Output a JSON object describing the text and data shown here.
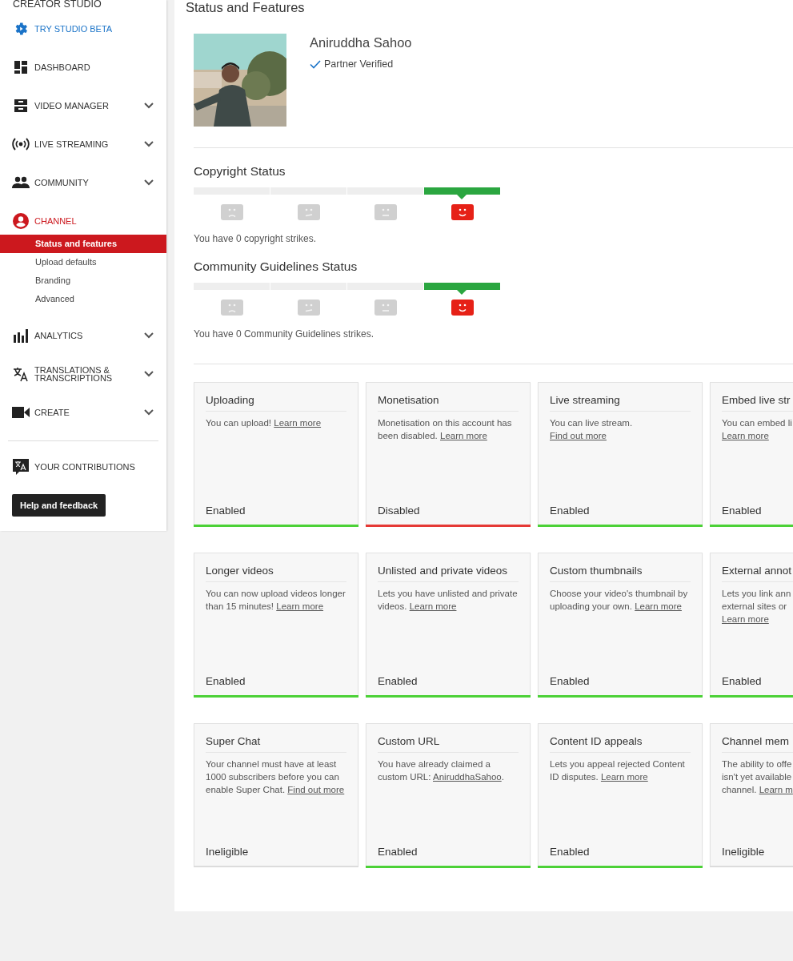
{
  "sidebar": {
    "heading": "CREATOR STUDIO",
    "items": [
      {
        "kind": "promo",
        "label": "TRY STUDIO BETA",
        "selected": false
      },
      {
        "kind": "link",
        "label": "DASHBOARD",
        "selected": false
      },
      {
        "kind": "group",
        "label": "VIDEO MANAGER",
        "selected": false,
        "expanded": false
      },
      {
        "kind": "group",
        "label": "LIVE STREAMING",
        "selected": false,
        "expanded": false
      },
      {
        "kind": "group",
        "label": "COMMUNITY",
        "selected": false,
        "expanded": false
      },
      {
        "kind": "link",
        "label": "CHANNEL",
        "selected": true,
        "children": [
          {
            "label": "Status and features",
            "selected": true
          },
          {
            "label": "Upload defaults",
            "selected": false
          },
          {
            "label": "Branding",
            "selected": false
          },
          {
            "label": "Advanced",
            "selected": false
          }
        ]
      },
      {
        "kind": "group",
        "label": "ANALYTICS",
        "selected": false,
        "expanded": false
      },
      {
        "kind": "group",
        "label": "TRANSLATIONS & TRANSCRIPTIONS",
        "selected": false,
        "expanded": false
      },
      {
        "kind": "group",
        "label": "CREATE",
        "selected": false,
        "expanded": false
      }
    ],
    "footer_items": [
      {
        "label": "YOUR CONTRIBUTIONS"
      }
    ],
    "help_button": "Help and feedback"
  },
  "page": {
    "title": "Status and Features",
    "profile": {
      "name": "Aniruddha Sahoo",
      "badge": "Partner Verified"
    },
    "statuses": [
      {
        "title": "Copyright Status",
        "meter": [
          {
            "kind": "sad",
            "selected": false
          },
          {
            "kind": "confused",
            "selected": false
          },
          {
            "kind": "neutral",
            "selected": false
          },
          {
            "kind": "happy",
            "selected": true
          }
        ],
        "message": "You have 0 copyright strikes."
      },
      {
        "title": "Community Guidelines Status",
        "meter": [
          {
            "kind": "sad",
            "selected": false
          },
          {
            "kind": "confused",
            "selected": false
          },
          {
            "kind": "neutral",
            "selected": false
          },
          {
            "kind": "happy",
            "selected": true
          }
        ],
        "message": "You have 0 Community Guidelines strikes."
      }
    ],
    "features": [
      {
        "title": "Uploading",
        "text": "You can upload! ",
        "link": "Learn more",
        "status": "Enabled",
        "kind": "enabled"
      },
      {
        "title": "Monetisation",
        "text": "Monetisation on this account has been disabled. ",
        "link": "Learn more",
        "status": "Disabled",
        "kind": "disabled"
      },
      {
        "title": "Live streaming",
        "text": "You can live stream. ",
        "link": "Find out more",
        "status": "Enabled",
        "kind": "enabled"
      },
      {
        "title": "Embed live str",
        "text": "You can embed li\n",
        "link": "Learn more",
        "status": "Enabled",
        "kind": "enabled"
      },
      {
        "title": "Longer videos",
        "text": "You can now upload videos longer than 15 minutes! ",
        "link": "Learn more",
        "status": "Enabled",
        "kind": "enabled"
      },
      {
        "title": "Unlisted and private videos",
        "text": "Lets you have unlisted and private videos. ",
        "link": "Learn more",
        "status": "Enabled",
        "kind": "enabled"
      },
      {
        "title": "Custom thumbnails",
        "text": "Choose your video's thumbnail by uploading your own. ",
        "link": "Learn more",
        "status": "Enabled",
        "kind": "enabled"
      },
      {
        "title": "External annot",
        "text": "Lets you link ann\nexternal sites or\n",
        "link": "Learn more",
        "status": "Enabled",
        "kind": "enabled"
      },
      {
        "title": "Super Chat",
        "text": "Your channel must have at least 1000 subscribers before you can enable Super Chat. ",
        "link": "Find out more",
        "status": "Ineligible",
        "kind": "ineligible"
      },
      {
        "title": "Custom URL",
        "text": "You have already claimed a custom URL: ",
        "link": "AniruddhaSahoo",
        "after": ".",
        "status": "Enabled",
        "kind": "enabled"
      },
      {
        "title": "Content ID appeals",
        "text": "Lets you appeal rejected Content ID disputes. ",
        "link": "Learn more",
        "status": "Enabled",
        "kind": "enabled"
      },
      {
        "title": "Channel mem",
        "text": "The ability to offe\nisn't yet available\nchannel. ",
        "link": "Learn m",
        "status": "Ineligible",
        "kind": "ineligible"
      }
    ]
  }
}
